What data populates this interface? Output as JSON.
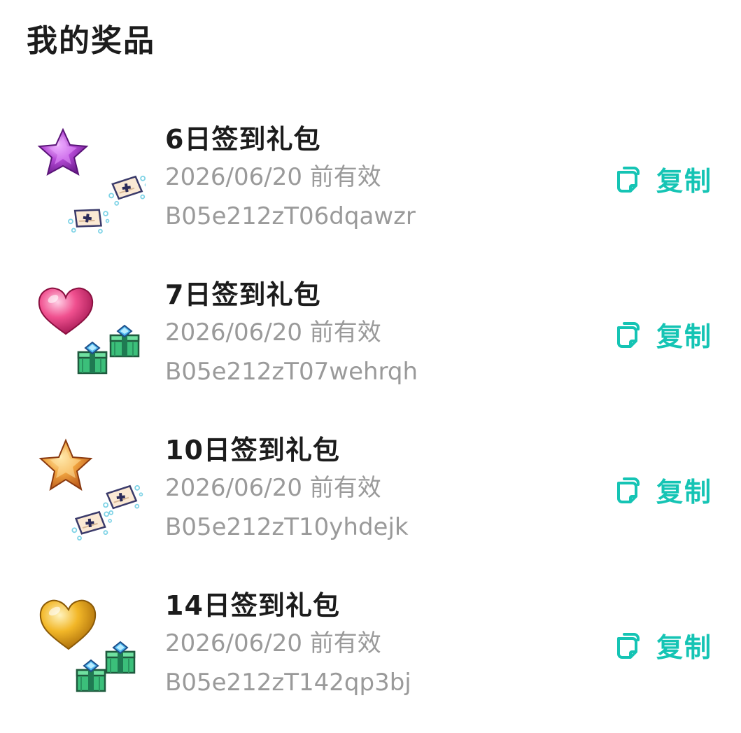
{
  "header": {
    "title": "我的奖品"
  },
  "colors": {
    "accent": "#15c4b4",
    "secondary_text": "#9a9a9a",
    "primary_text": "#1c1c1c"
  },
  "prizes": [
    {
      "name": "6日签到礼包",
      "expiry": "2026/06/20 前有效",
      "code": "B05e212zT06dqawzr",
      "copy_label": "复制",
      "icon": "purple-star-with-tickets-icon"
    },
    {
      "name": "7日签到礼包",
      "expiry": "2026/06/20 前有效",
      "code": "B05e212zT07wehrqh",
      "copy_label": "复制",
      "icon": "pink-heart-with-gift-boxes-icon"
    },
    {
      "name": "10日签到礼包",
      "expiry": "2026/06/20 前有效",
      "code": "B05e212zT10yhdejk",
      "copy_label": "复制",
      "icon": "orange-star-with-tickets-icon"
    },
    {
      "name": "14日签到礼包",
      "expiry": "2026/06/20 前有效",
      "code": "B05e212zT142qp3bj",
      "copy_label": "复制",
      "icon": "gold-heart-with-gift-boxes-icon"
    }
  ]
}
